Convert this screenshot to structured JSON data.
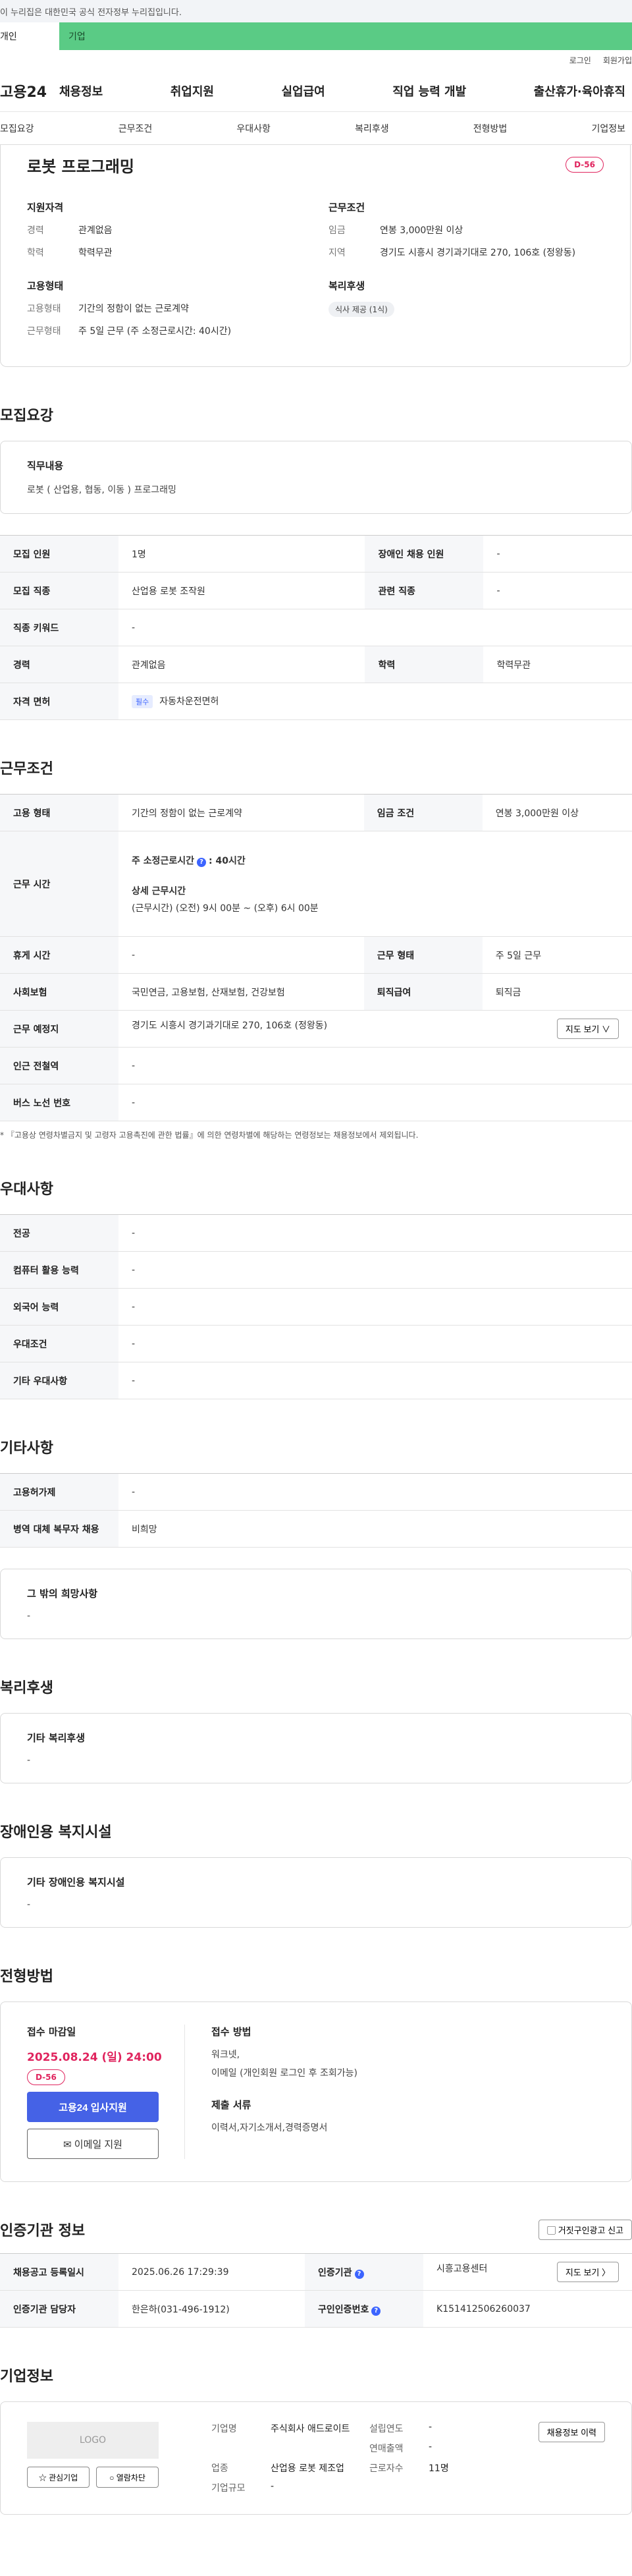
{
  "topbar": {
    "notice": "이 누리집은 대한민국 공식 전자정부 누리집입니다."
  },
  "tabs": {
    "personal": "개인",
    "company": "기업"
  },
  "util": {
    "login": "로그인",
    "join": "회원가입"
  },
  "gnb": {
    "logo": "고용24",
    "menu": [
      "채용정보",
      "취업지원",
      "실업급여",
      "직업 능력 개발",
      "출산휴가·육아휴직"
    ]
  },
  "subnav": [
    "모집요강",
    "근무조건",
    "우대사항",
    "복리후생",
    "전형방법",
    "기업정보"
  ],
  "summary": {
    "title": "로봇 프로그래밍",
    "dday": "D-56",
    "support_title": "지원자격",
    "career_k": "경력",
    "career_v": "관계없음",
    "edu_k": "학력",
    "edu_v": "학력무관",
    "emp_title": "고용형태",
    "emptype_k": "고용형태",
    "emptype_v": "기간의 정함이 없는 근로계약",
    "workshape_k": "근무형태",
    "workshape_v": "주 5일 근무 (주 소정근로시간: 40시간)",
    "cond_title": "근무조건",
    "wage_k": "임금",
    "wage_v": "연봉 3,000만원 이상",
    "region_k": "지역",
    "region_v": "경기도 시흥시 경기과기대로 270, 106호 (정왕동)",
    "welfare_title": "복리후생",
    "welfare_pill": "식사 제공 (1식)"
  },
  "recruit": {
    "title": "모집요강",
    "duty_title": "직무내용",
    "duty_value": "로봇 ( 산업용, 협동, 이동 ) 프로그래밍",
    "rows": [
      [
        "모집 인원",
        "1명",
        "장애인 채용 인원",
        "-"
      ],
      [
        "모집 직종",
        "산업용 로봇 조작원",
        "관련 직종",
        "-"
      ]
    ],
    "keyword_k": "직종 키워드",
    "keyword_v": "-",
    "career_k": "경력",
    "career_v": "관계없음",
    "edu_k": "학력",
    "edu_v": "학력무관",
    "license_k": "자격 면허",
    "license_badge": "필수",
    "license_v": "자동차운전면허"
  },
  "work": {
    "title": "근무조건",
    "emptype_k": "고용 형태",
    "emptype_v": "기간의 정함이 없는 근로계약",
    "wage_k": "임금 조건",
    "wage_v": "연봉 3,000만원 이상",
    "hours_k": "근무 시간",
    "hours_line1_a": "주 소정근로시간",
    "hours_line1_b": ": 40시간",
    "hours_line2": "상세 근무시간",
    "hours_line3": "(근무시간) (오전) 9시 00분 ~ (오후) 6시 00분",
    "rest_k": "휴게 시간",
    "rest_v": "-",
    "shape_k": "근무 형태",
    "shape_v": "주 5일 근무",
    "ins_k": "사회보험",
    "ins_v": "국민연금, 고용보험, 산재보험, 건강보험",
    "sev_k": "퇴직급여",
    "sev_v": "퇴직금",
    "place_k": "근무 예정지",
    "place_v": "경기도 시흥시 경기과기대로 270, 106호 (정왕동)",
    "map_btn": "지도 보기 ∨",
    "subway_k": "인근 전철역",
    "subway_v": "-",
    "bus_k": "버스 노선 번호",
    "bus_v": "-",
    "note": "* 『고용상 연령차별금지 및 고령자 고용촉진에 관한 법률』에 의한 연령차별에 해당하는 연령정보는 채용정보에서 제외됩니다."
  },
  "pref": {
    "title": "우대사항",
    "rows": [
      [
        "전공",
        "-"
      ],
      [
        "컴퓨터 활용 능력",
        "-"
      ],
      [
        "외국어 능력",
        "-"
      ],
      [
        "우대조건",
        "-"
      ],
      [
        "기타 우대사항",
        "-"
      ]
    ]
  },
  "etc": {
    "title": "기타사항",
    "rows": [
      [
        "고용허가제",
        "-"
      ],
      [
        "병역 대체 복무자 채용",
        "비희망"
      ]
    ],
    "other_title": "그 밖의 희망사항",
    "other_value": "-"
  },
  "welfare": {
    "title": "복리후생",
    "box_title": "기타 복리후생",
    "box_value": "-"
  },
  "disabled": {
    "title": "장애인용 복지시설",
    "box_title": "기타 장애인용 복지시설",
    "box_value": "-"
  },
  "process": {
    "title": "전형방법",
    "deadline_title": "접수 마감일",
    "deadline": "2025.08.24 (일) 24:00",
    "dday": "D-56",
    "apply_btn": "고용24 입사지원",
    "email_btn": "이메일 지원",
    "method_title": "접수 방법",
    "method_1": "워크넷,",
    "method_2": "이메일 (개인회원 로그인 후 조회가능)",
    "docs_title": "제출 서류",
    "docs_value": "이력서,자기소개서,경력증명서"
  },
  "agency": {
    "title": "인증기관 정보",
    "report_btn": "거짓구인광고 신고",
    "reg_k": "채용공고 등록일시",
    "reg_v": "2025.06.26 17:29:39",
    "org_k": "인증기관",
    "org_v": "시흥고용센터",
    "map_btn": "지도 보기 〉",
    "mgr_k": "인증기관 담당자",
    "mgr_v": "한은하(031-496-1912)",
    "cert_k": "구인인증번호",
    "cert_v": "K151412506260037"
  },
  "companyinfo": {
    "title": "기업정보",
    "logo": "LOGO",
    "fav_btn": "관심기업",
    "block_btn": "열람차단",
    "name_k": "기업명",
    "name_v": "주식회사 애드로이트",
    "ind_k": "업종",
    "ind_v": "산업용 로봇 제조업",
    "size_k": "기업규모",
    "size_v": "-",
    "year_k": "설립연도",
    "year_v": "-",
    "sales_k": "연매출액",
    "sales_v": "-",
    "emp_k": "근로자수",
    "emp_v": "11명",
    "history_btn": "채용정보 이력"
  }
}
